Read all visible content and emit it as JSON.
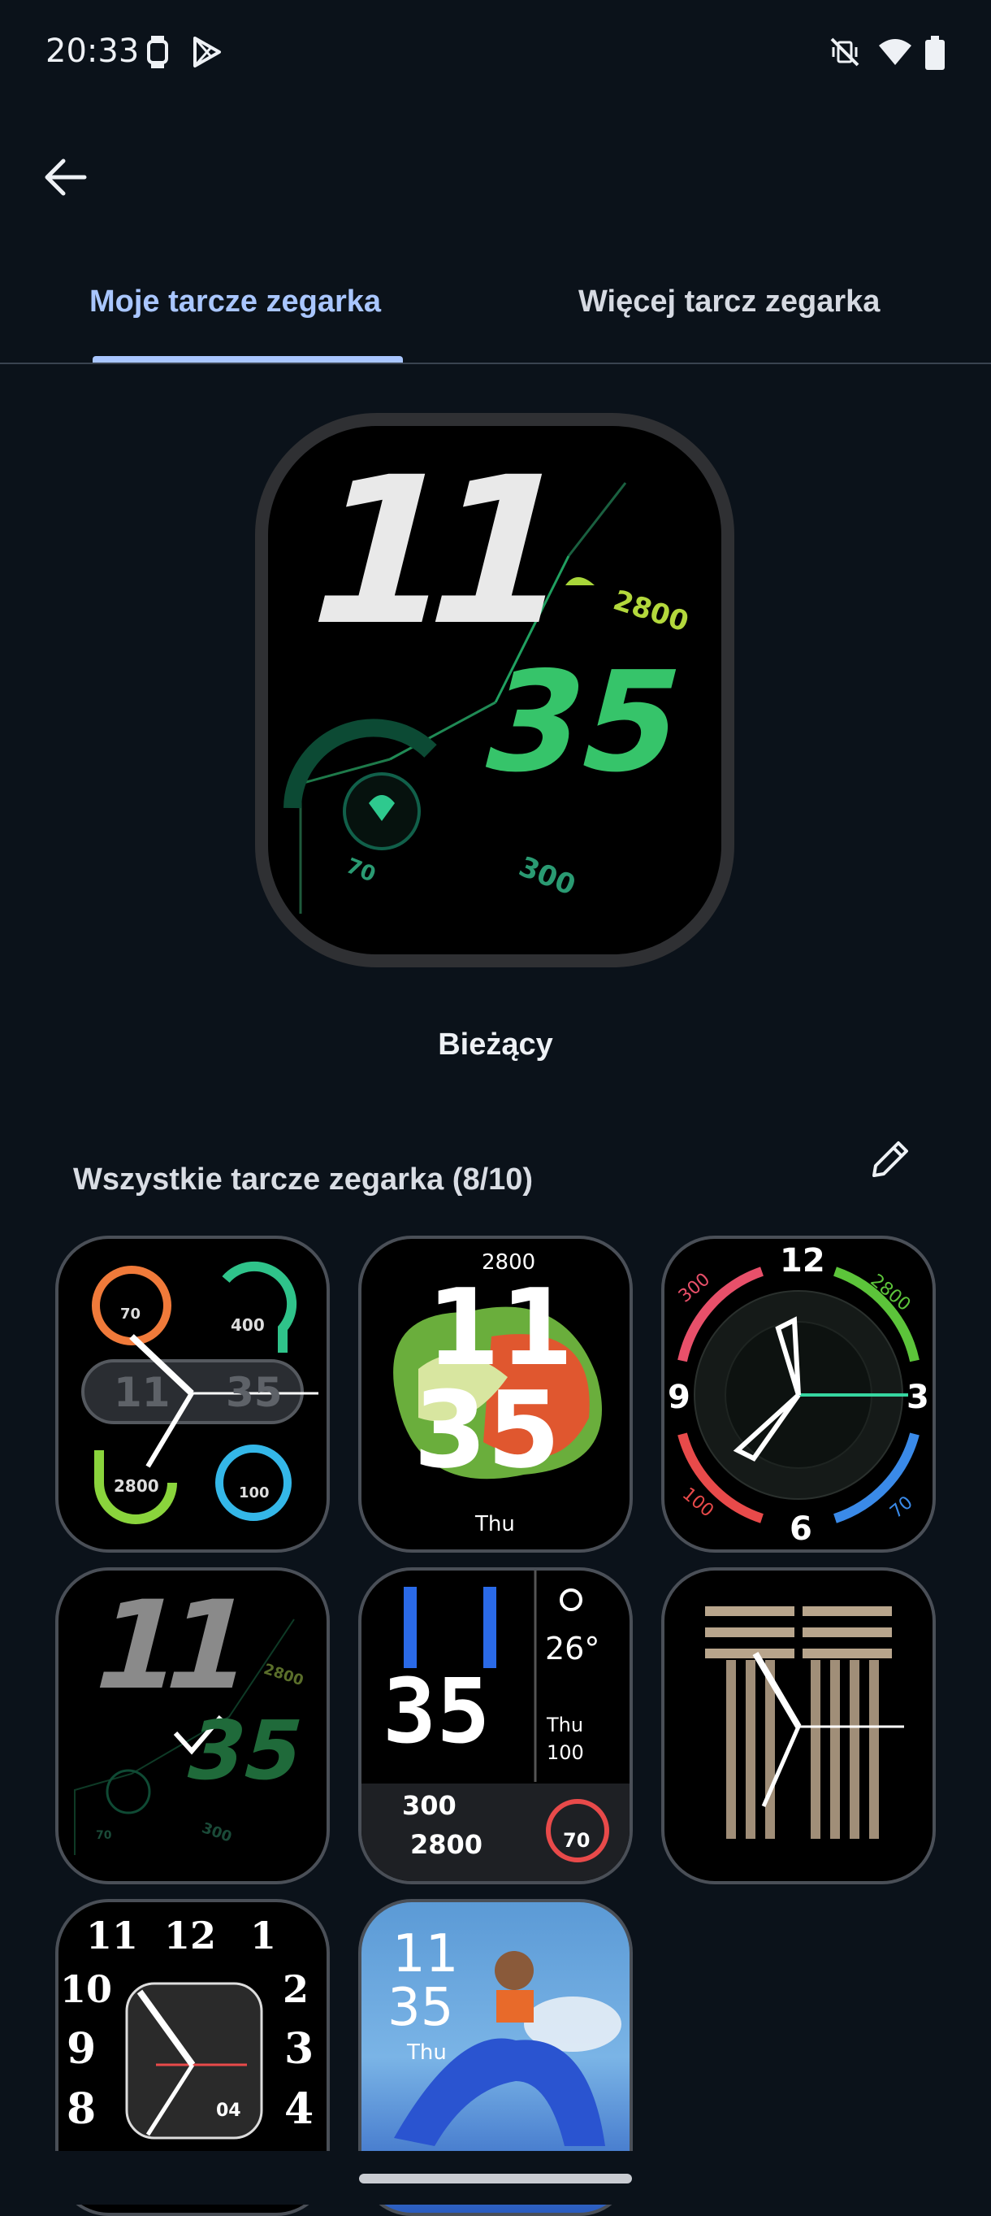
{
  "status_bar": {
    "time": "20:33",
    "icons": [
      "watch-icon",
      "play-store-icon",
      "mute-vibrate-icon",
      "wifi-icon",
      "battery-icon"
    ]
  },
  "nav": {
    "back_icon": "arrow-left-icon"
  },
  "tabs": [
    {
      "label": "Moje tarcze zegarka",
      "selected": true
    },
    {
      "label": "Więcej tarcz zegarka",
      "selected": false
    }
  ],
  "current_face": {
    "hour": "11",
    "minute": "35",
    "steps": "2800",
    "heart_rate": "70",
    "calories": "300",
    "caption": "Bieżący"
  },
  "all_faces": {
    "title": "Wszystkie tarcze zegarka (8/10)",
    "edit_icon": "pencil-icon",
    "faces": [
      {
        "id": "face-1",
        "values": [
          "70",
          "400",
          "11",
          "35",
          "2800",
          "100"
        ]
      },
      {
        "id": "face-2",
        "steps": "2800",
        "hour": "11",
        "minute": "35",
        "day": "Thu"
      },
      {
        "id": "face-3",
        "numerals": [
          "12",
          "3",
          "6",
          "9"
        ],
        "values": [
          "300",
          "2800",
          "100",
          "70"
        ]
      },
      {
        "id": "face-4",
        "hour": "11",
        "minute": "35",
        "steps": "2800",
        "heart_rate": "70",
        "calories": "300",
        "selected": true
      },
      {
        "id": "face-5",
        "hour": "11",
        "minute": "35",
        "temp": "26°",
        "day": "Thu",
        "battery": "100",
        "calories": "300",
        "steps": "2800",
        "heart_rate": "70"
      },
      {
        "id": "face-6"
      },
      {
        "id": "face-7",
        "numerals": [
          "11",
          "12",
          "1",
          "10",
          "2",
          "9",
          "3",
          "8",
          "4"
        ],
        "date": "04"
      },
      {
        "id": "face-8",
        "hour": "11",
        "minute": "35",
        "day": "Thu"
      }
    ]
  },
  "colors": {
    "accent": "#a9c6ff",
    "background": "#0b121a"
  }
}
